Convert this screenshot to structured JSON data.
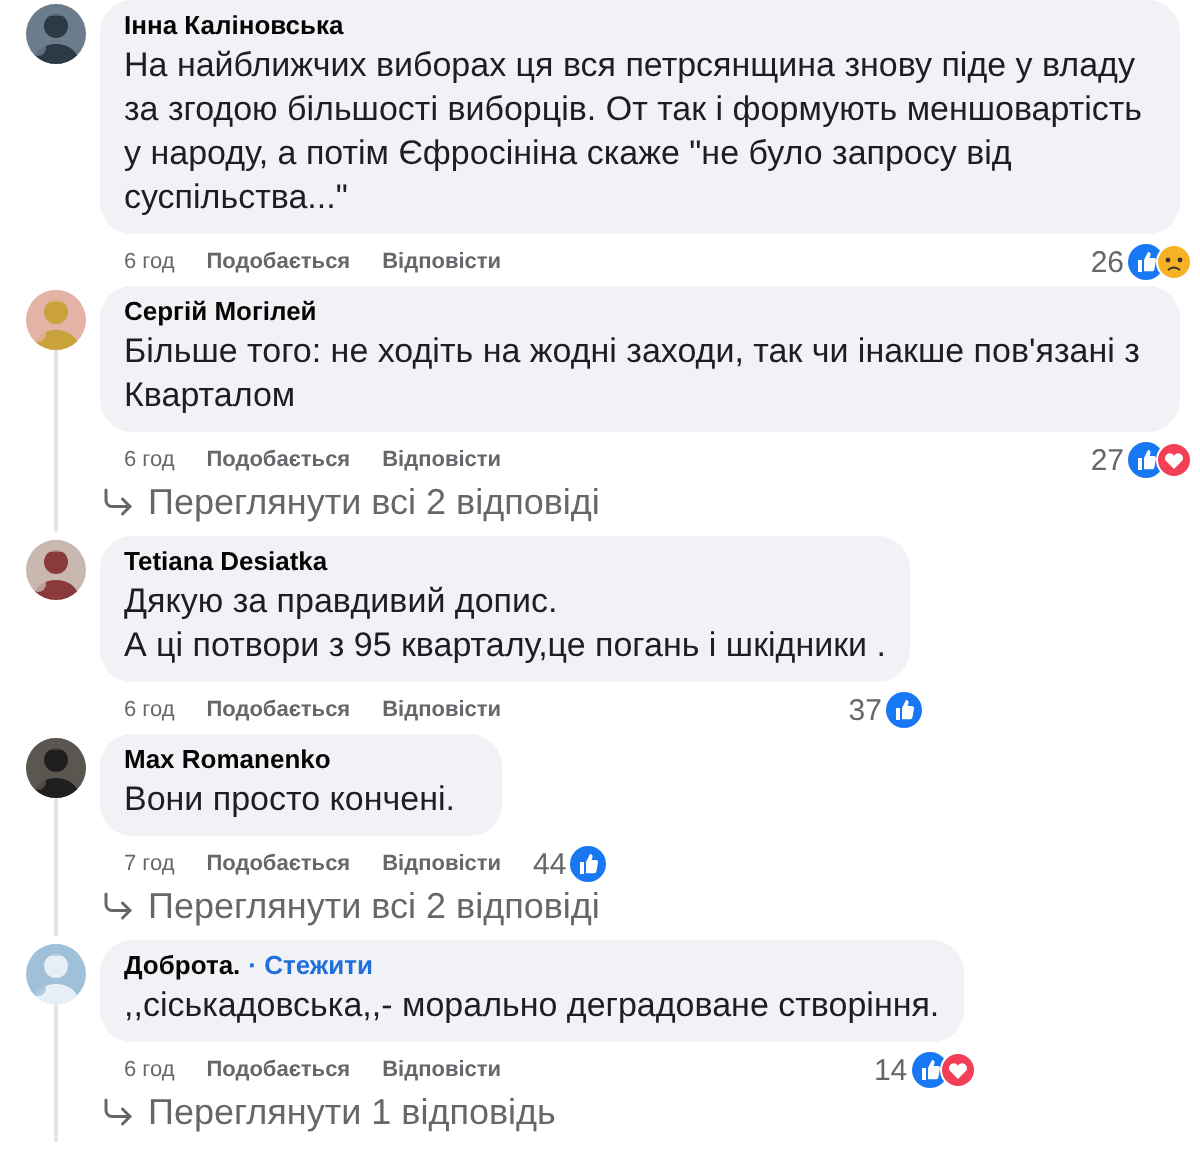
{
  "comments": [
    {
      "author": "Інна Каліновська",
      "text": "На найближчих виборах ця вся петрсянщина знову піде у владу за згодою більшості виборців. От так і формують меншовартість у народу, а потім Єфросініна скаже \"не було запросу від суспільства...\"",
      "time": "6 год",
      "like": "Подобається",
      "reply": "Відповісти",
      "reaction_count": "26",
      "reactions": [
        {
          "kind": "like"
        },
        {
          "kind": "sad"
        }
      ]
    },
    {
      "author": "Сергій Могілей",
      "text": "Більше того: не ходіть на жодні заходи, так чи інакше пов'язані з Кварталом",
      "time": "6 год",
      "like": "Подобається",
      "reply": "Відповісти",
      "reaction_count": "27",
      "reactions": [
        {
          "kind": "like"
        },
        {
          "kind": "love"
        }
      ],
      "replies_link": "Переглянути всі 2 відповіді"
    },
    {
      "author": "Tetiana Desiatka",
      "text": "Дякую за правдивий допис.\nА ці потвори з 95 кварталу,це погань і шкідники .",
      "time": "6 год",
      "like": "Подобається",
      "reply": "Відповісти",
      "reaction_count": "37",
      "reactions": [
        {
          "kind": "like"
        }
      ]
    },
    {
      "author": "Max Romanenko",
      "text": "Вони просто кончені.",
      "time": "7 год",
      "like": "Подобається",
      "reply": "Відповісти",
      "reaction_count": "44",
      "reactions": [
        {
          "kind": "like"
        }
      ],
      "replies_link": "Переглянути всі 2 відповіді"
    },
    {
      "author": "Доброта.",
      "follow": "· Стежити",
      "text": ",,сіськадовська,,- морально деградоване створіння.",
      "time": "6 год",
      "like": "Подобається",
      "reply": "Відповісти",
      "reaction_count": "14",
      "reactions": [
        {
          "kind": "like"
        },
        {
          "kind": "love"
        }
      ],
      "replies_link": "Переглянути 1 відповідь"
    }
  ]
}
